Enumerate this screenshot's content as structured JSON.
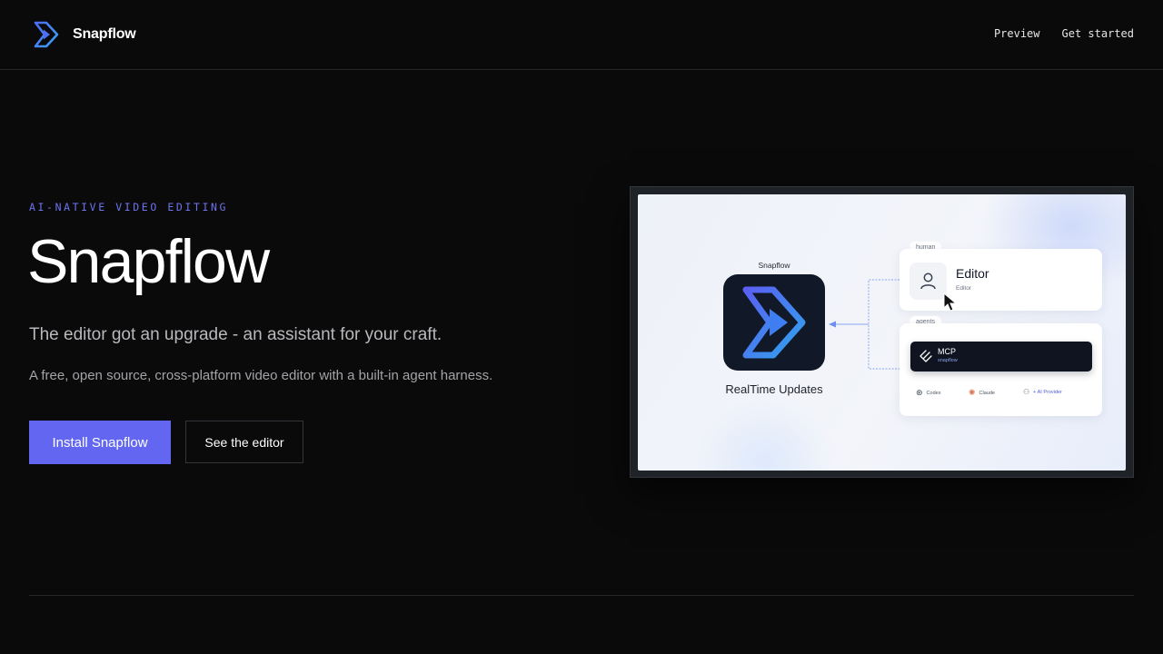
{
  "nav": {
    "brand": "Snapflow",
    "links": [
      "Preview",
      "Get started"
    ]
  },
  "hero": {
    "eyebrow": "AI-NATIVE VIDEO EDITING",
    "title": "Snapflow",
    "tagline": "The editor got an upgrade - an assistant for your craft.",
    "description": "A free, open source, cross-platform video editor with a built-in agent harness.",
    "primary_cta": "Install Snapflow",
    "secondary_cta": "See the editor"
  },
  "preview": {
    "app_label": "Snapflow",
    "app_caption": "RealTime Updates",
    "human_tab": "human",
    "editor_title": "Editor",
    "editor_subtitle": "Editor",
    "agents_tab": "agents",
    "mcp_title": "MCP",
    "mcp_subtitle": "snapflow",
    "agents": [
      {
        "label": "Codex",
        "icon": "codex-icon"
      },
      {
        "label": "Claude",
        "icon": "claude-icon"
      },
      {
        "label": "+ AI Provider",
        "icon": "ai-provider-icon"
      }
    ]
  },
  "colors": {
    "background": "#0a0a0a",
    "accent": "#6366f1",
    "eyebrow": "#6d73ee",
    "connector": "#a9c2f5"
  }
}
